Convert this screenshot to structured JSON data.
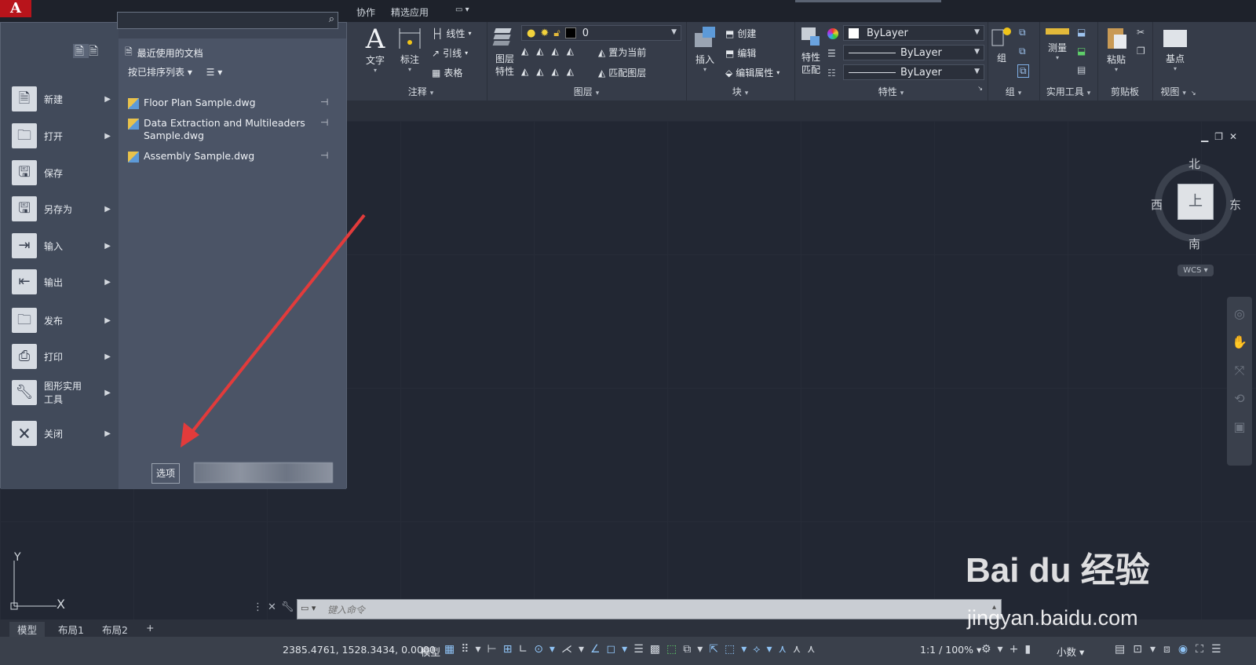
{
  "app": {
    "logo_letter": "A"
  },
  "top_tabs": {
    "collab": "协作",
    "featured": "精选应用"
  },
  "app_menu": {
    "search_placeholder": "",
    "items": [
      {
        "label": "新建",
        "has_submenu": true,
        "icon": "new-file-icon"
      },
      {
        "label": "打开",
        "has_submenu": true,
        "icon": "open-folder-icon"
      },
      {
        "label": "保存",
        "has_submenu": false,
        "icon": "save-icon"
      },
      {
        "label": "另存为",
        "has_submenu": true,
        "icon": "save-as-icon"
      },
      {
        "label": "输入",
        "has_submenu": true,
        "icon": "import-icon"
      },
      {
        "label": "输出",
        "has_submenu": true,
        "icon": "export-icon"
      },
      {
        "label": "发布",
        "has_submenu": true,
        "icon": "publish-icon"
      },
      {
        "label": "打印",
        "has_submenu": true,
        "icon": "print-icon"
      },
      {
        "label": "图形实用\n工具",
        "has_submenu": true,
        "icon": "drawing-utilities-icon"
      },
      {
        "label": "关闭",
        "has_submenu": true,
        "icon": "close-doc-icon"
      }
    ],
    "recent_title": "最近使用的文档",
    "sort_label": "按已排序列表",
    "recent_docs": [
      {
        "name": "Floor Plan Sample.dwg"
      },
      {
        "name": "Data Extraction and Multileaders Sample.dwg"
      },
      {
        "name": "Assembly Sample.dwg"
      }
    ],
    "options_button": "选项"
  },
  "ribbon": {
    "annotation": {
      "title": "注释",
      "text": "文字",
      "dimension": "标注",
      "linear": "线性",
      "leader": "引线",
      "table": "表格"
    },
    "layers": {
      "title": "图层",
      "layer_props": "图层\n特性",
      "current_layer": "0",
      "make_current": "置为当前",
      "match_layer": "匹配图层"
    },
    "block": {
      "title": "块",
      "insert": "插入",
      "create": "创建",
      "edit": "编辑",
      "edit_attributes": "编辑属性"
    },
    "properties": {
      "title": "特性",
      "match": "特性\n匹配",
      "color": "ByLayer",
      "linetype": "ByLayer",
      "lineweight": "ByLayer"
    },
    "groups": {
      "title": "组",
      "group": "组"
    },
    "utilities": {
      "title": "实用工具",
      "measure": "测量"
    },
    "clipboard": {
      "title": "剪贴板",
      "paste": "粘贴"
    },
    "view": {
      "title": "视图",
      "base": "基点"
    }
  },
  "viewcube": {
    "north": "北",
    "south": "南",
    "east": "东",
    "west": "西",
    "face": "上",
    "wcs": "WCS"
  },
  "ucs": {
    "y": "Y",
    "x": "X"
  },
  "command": {
    "placeholder": "键入命令"
  },
  "layout_tabs": [
    "模型",
    "布局1",
    "布局2",
    "+"
  ],
  "status": {
    "coords": "2385.4761, 1528.3434, 0.0000",
    "model": "模型",
    "scale": "1:1 / 100%",
    "units": "小数"
  },
  "watermark": {
    "brand": "Bai du 经验",
    "url": "jingyan.baidu.com"
  },
  "colors": {
    "accent_red": "#b8141b",
    "arrow": "#e23b3b",
    "panel": "#4b5466"
  }
}
